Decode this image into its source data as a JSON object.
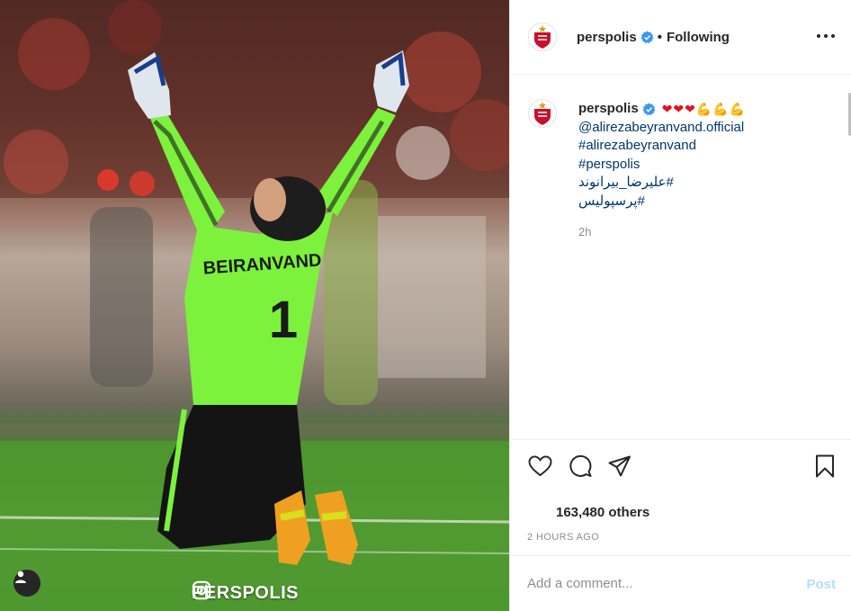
{
  "header": {
    "username": "perspolis",
    "separator": "•",
    "follow_status": "Following",
    "avatar_icon": "perspolis-logo-icon",
    "more_icon": "more-options-icon"
  },
  "caption": {
    "username": "perspolis",
    "emojis": {
      "hearts": "❤❤❤",
      "arms": "💪💪💪"
    },
    "lines": [
      "@alirezabeyranvand.official",
      "#alirezabeyranvand",
      "#perspolis",
      "#علیرضا_بیرانوند",
      "#پرسپولیس"
    ],
    "time": "2h"
  },
  "actions": {
    "like_icon": "heart-icon",
    "comment_icon": "comment-icon",
    "share_icon": "share-icon",
    "save_icon": "bookmark-icon"
  },
  "likes": "163,480 others",
  "timestamp": "2 HOURS AGO",
  "comment": {
    "placeholder": "Add a comment...",
    "post_label": "Post"
  },
  "photo": {
    "watermark": "PERSPOLIS",
    "jersey_name": "BEIRANVAND",
    "jersey_number": "1"
  },
  "colors": {
    "link": "#00376b",
    "muted": "#8e8e8e",
    "post_disabled": "#b2dffc",
    "verified": "#3897f0",
    "jersey": "#7cf23c"
  }
}
